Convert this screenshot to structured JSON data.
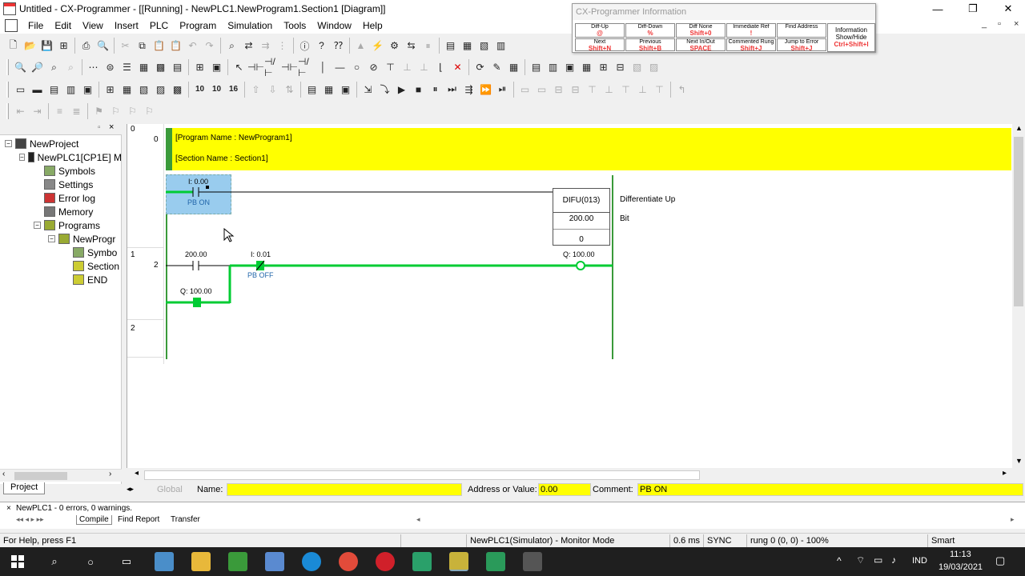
{
  "window": {
    "title": "Untitled - CX-Programmer - [[Running] - NewPLC1.NewProgram1.Section1 [Diagram]]",
    "minimize": "—",
    "maximize": "❐",
    "close": "✕"
  },
  "menu": [
    "File",
    "Edit",
    "View",
    "Insert",
    "PLC",
    "Program",
    "Simulation",
    "Tools",
    "Window",
    "Help"
  ],
  "mdi_controls": [
    "_",
    "▫",
    "×"
  ],
  "info_window": {
    "title": "CX-Programmer Information",
    "cells": [
      {
        "label": "Diff-Up",
        "key": "@"
      },
      {
        "label": "Diff-Down",
        "key": "%"
      },
      {
        "label": "Diff None",
        "key": "Shift+0"
      },
      {
        "label": "Immediate Ref",
        "key": "!"
      },
      {
        "label": "Find Address",
        "key": ""
      },
      {
        "label": "Next",
        "key": "Shift+N"
      },
      {
        "label": "Previous",
        "key": "Shift+B"
      },
      {
        "label": "Next In/Out",
        "key": "SPACE"
      },
      {
        "label": "Commented Rung",
        "key": "Shift+J"
      },
      {
        "label": "Jump to Error",
        "key": "Shift+J"
      }
    ],
    "side": {
      "label": "Information Show/Hide",
      "key": "Ctrl+Shift+I"
    }
  },
  "tree": {
    "items": [
      {
        "label": "NewProject",
        "depth": 0,
        "exp": "−",
        "icon": "project-icon"
      },
      {
        "label": "NewPLC1[CP1E] M",
        "depth": 1,
        "exp": "−",
        "icon": "plc-icon"
      },
      {
        "label": "Symbols",
        "depth": 2,
        "exp": "",
        "icon": "symbols-icon"
      },
      {
        "label": "Settings",
        "depth": 2,
        "exp": "",
        "icon": "settings-icon"
      },
      {
        "label": "Error log",
        "depth": 2,
        "exp": "",
        "icon": "error-log-icon"
      },
      {
        "label": "Memory",
        "depth": 2,
        "exp": "",
        "icon": "memory-icon"
      },
      {
        "label": "Programs",
        "depth": 2,
        "exp": "−",
        "icon": "programs-icon"
      },
      {
        "label": "NewProgr",
        "depth": 3,
        "exp": "−",
        "icon": "program-icon"
      },
      {
        "label": "Symbo",
        "depth": 4,
        "exp": "",
        "icon": "symbols-icon"
      },
      {
        "label": "Section",
        "depth": 4,
        "exp": "",
        "icon": "section-icon"
      },
      {
        "label": "END",
        "depth": 4,
        "exp": "",
        "icon": "end-icon"
      }
    ],
    "tab": "Project"
  },
  "diagram": {
    "header_rung": "0",
    "header_step": "0",
    "program_name": "[Program Name : NewProgram1]",
    "section_name": "[Section Name : Section1]",
    "rung0": {
      "contact_addr": "I: 0.00",
      "contact_comment": "PB ON",
      "instr": "DIFU(013)",
      "operand": "200.00",
      "count": "0",
      "instr_comment": "Differentiate Up",
      "operand_comment": "Bit"
    },
    "rung1": {
      "rung_no": "1",
      "step_no": "2",
      "contact1_addr": "200.00",
      "contact2_addr": "I: 0.01",
      "contact2_comment": "PB OFF",
      "coil_addr": "Q: 100.00",
      "self_hold_addr": "Q: 100.00"
    },
    "rung2": {
      "rung_no": "2"
    }
  },
  "namebar": {
    "global": "Global",
    "name_label": "Name:",
    "addr_label": "Address or Value:",
    "addr_value": "0.00",
    "comment_label": "Comment:",
    "comment_value": "PB ON"
  },
  "output": {
    "message": "NewPLC1 - 0 errors, 0 warnings.",
    "tabs": [
      "Compile",
      "Find Report",
      "Transfer"
    ]
  },
  "status": {
    "help": "For Help, press F1",
    "mode": "NewPLC1(Simulator) - Monitor Mode",
    "cycle": "0.6 ms",
    "sync": "SYNC",
    "position": "rung 0 (0, 0)  - 100%",
    "smart": "Smart"
  },
  "taskbar": {
    "lang": "IND",
    "time": "11:13",
    "date": "19/03/2021"
  },
  "colors": {
    "rung_header": "#ffff00",
    "power_flow": "#00cc33",
    "selection": "#99ccee"
  }
}
